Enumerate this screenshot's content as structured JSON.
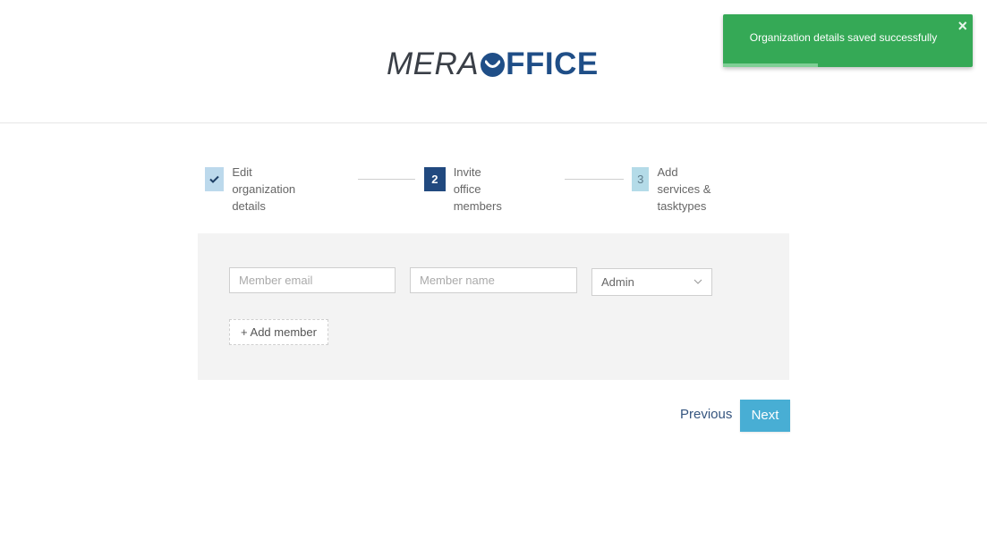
{
  "logo": {
    "part1": "MERA",
    "part2_after_mark": "FFICE"
  },
  "toast": {
    "message": "Organization details saved successfully",
    "close_symbol": "×",
    "progress": 0.38,
    "color": "#35a956"
  },
  "steps": [
    {
      "status": "done",
      "badge": "",
      "icon": "check-icon",
      "line1": "Edit organization",
      "line2": "details"
    },
    {
      "status": "active",
      "badge": "2",
      "line1": "Invite office",
      "line2": "members"
    },
    {
      "status": "pending",
      "badge": "3",
      "line1": "Add services &",
      "line2": "tasktypes"
    }
  ],
  "form": {
    "email_placeholder": "Member email",
    "name_placeholder": "Member name",
    "role_value": "Admin",
    "add_member_label": "+ Add member"
  },
  "footer": {
    "previous_label": "Previous",
    "next_label": "Next"
  },
  "colors": {
    "primary": "#21497f",
    "accent": "#48aed4",
    "success": "#35a956"
  }
}
